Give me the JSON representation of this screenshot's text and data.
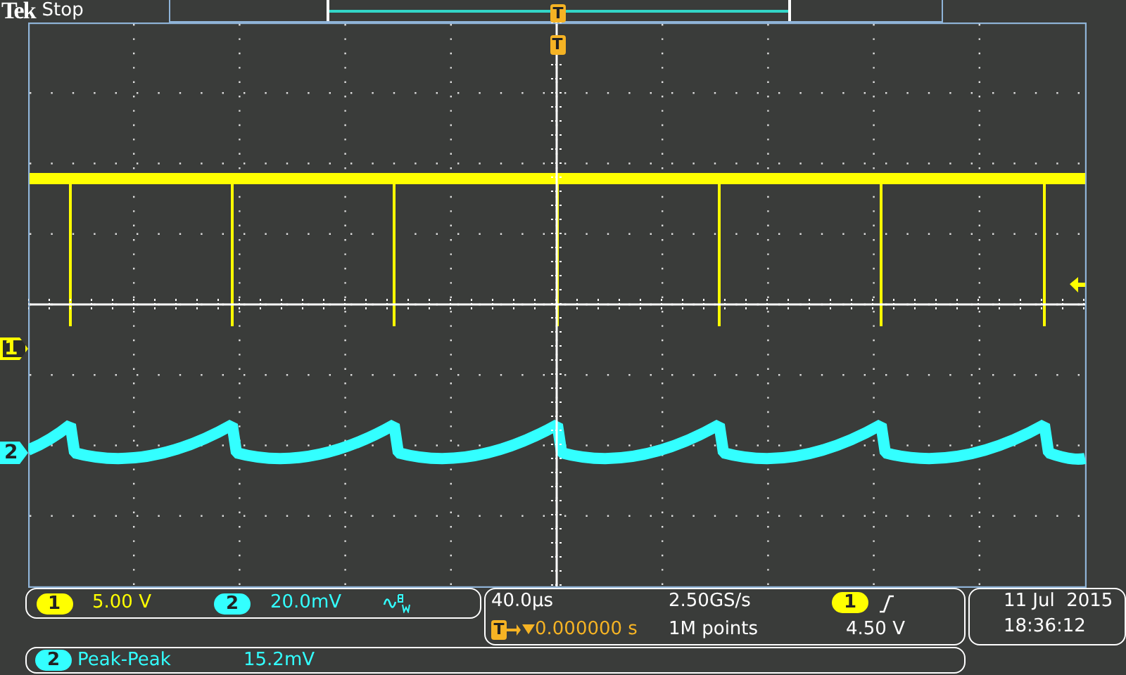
{
  "header": {
    "brand": "Tek",
    "acquisition_state": "Stop"
  },
  "record_bar": {
    "trigger_mark": "T"
  },
  "graticule": {
    "trigger_mark": "T",
    "channel_markers": [
      {
        "label": "1",
        "color": "#ffff00",
        "selected": false
      },
      {
        "label": "2",
        "color": "#33ffff",
        "selected": true
      }
    ]
  },
  "channels": [
    {
      "number": "1",
      "scale": "5.00 V",
      "color": "#ffff00",
      "bandwidth_limited": false
    },
    {
      "number": "2",
      "scale": "20.0mV",
      "color": "#33ffff",
      "bandwidth_limited": true
    }
  ],
  "timebase": {
    "scale": "40.0µs",
    "trigger_mark": "T",
    "trigger_delay": "0.000000 s",
    "sample_rate": "2.50GS/s",
    "record_length": "1M points"
  },
  "trigger": {
    "source": "1",
    "level": "4.50 V"
  },
  "datetime": {
    "date": "11 Jul  2015",
    "time": "18:36:12"
  },
  "measurements": [
    {
      "channel": "2",
      "name": "Peak-Peak",
      "value": "15.2mV"
    }
  ]
}
